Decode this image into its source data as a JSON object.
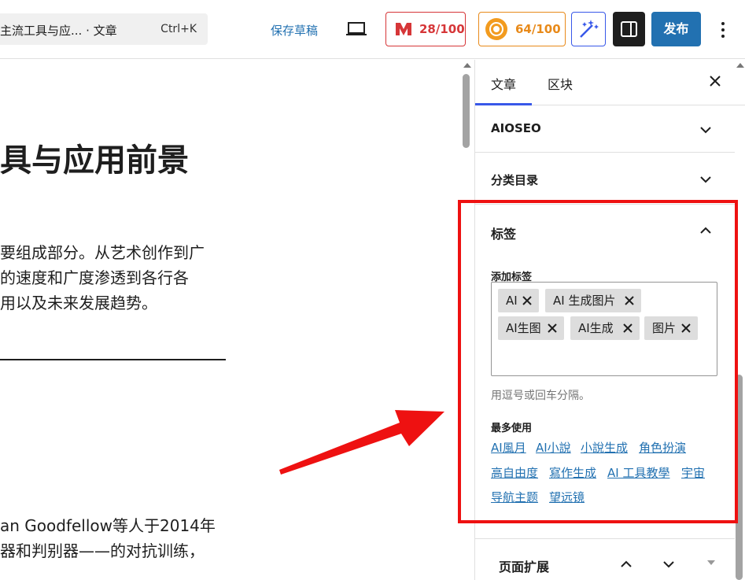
{
  "toolbar": {
    "command_title": "主流工具与应...",
    "command_suffix": "· 文章",
    "command_shortcut": "Ctrl+K",
    "save_draft": "保存草稿",
    "seo_score": "28/100",
    "aioseo_score": "64/100",
    "publish": "发布",
    "colors": {
      "seo": "#d63638",
      "aioseo": "#e88a1a",
      "accent": "#3858e9",
      "publish": "#2271b1"
    }
  },
  "editor": {
    "title": "具与应用前景",
    "paragraph1": [
      "要组成部分。从艺术创作到广",
      "的速度和广度渗透到各行各",
      "用以及未来发展趋势。"
    ],
    "paragraph2": [
      "an Goodfellow等人于2014年",
      "器和判别器——的对抗训练，"
    ]
  },
  "sidebar": {
    "tabs": [
      "文章",
      "区块"
    ],
    "panels": {
      "aioseo": "AIOSEO",
      "categories": "分类目录"
    },
    "tags": {
      "title": "标签",
      "add_label": "添加标签",
      "chips": [
        "AI",
        "AI 生成图片",
        "AI生图",
        "AI生成",
        "图片"
      ],
      "help": "用逗号或回车分隔。",
      "most_used_label": "最多使用",
      "most_used": [
        "AI風月",
        "AI小說",
        "小說生成",
        "角色扮演",
        "高自由度",
        "寫作生成",
        "AI 工具教學",
        "宇宙",
        "导航主题",
        "望远镜"
      ]
    },
    "page_extension": "页面扩展"
  }
}
